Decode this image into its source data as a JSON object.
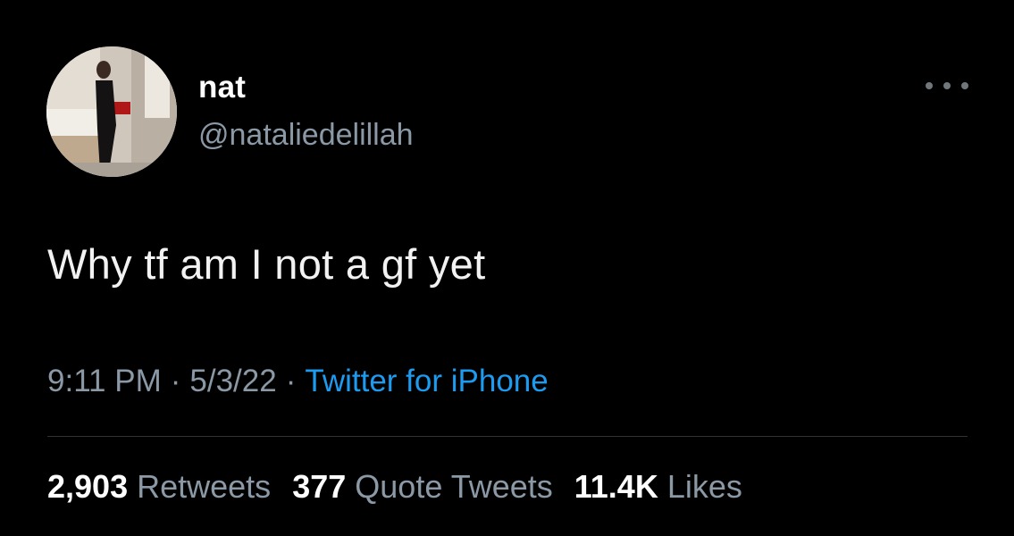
{
  "author": {
    "display_name": "nat",
    "handle": "@nataliedelillah"
  },
  "tweet": {
    "text": "Why tf am I not a gf yet",
    "time": "9:11 PM",
    "date": "5/3/22",
    "separator": "·",
    "source": "Twitter for iPhone"
  },
  "stats": {
    "retweets_count": "2,903",
    "retweets_label": "Retweets",
    "quotes_count": "377",
    "quotes_label": "Quote Tweets",
    "likes_count": "11.4K",
    "likes_label": "Likes"
  },
  "icons": {
    "more": "more-horizontal-icon"
  },
  "colors": {
    "background": "#000000",
    "primary_text": "#e7e9ea",
    "secondary_text": "#8b98a5",
    "link": "#1d9bf0",
    "divider": "#2f3336"
  }
}
